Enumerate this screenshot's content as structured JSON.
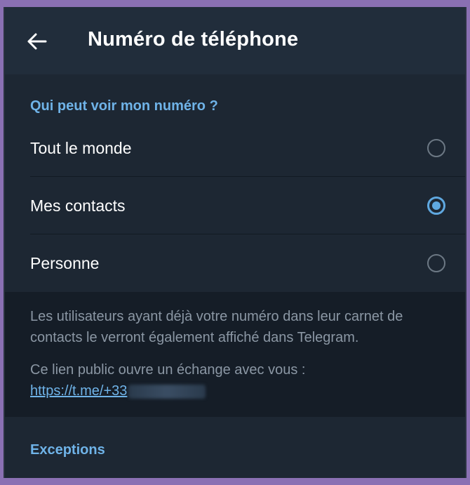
{
  "header": {
    "title": "Numéro de téléphone",
    "back_icon": "arrow-left-icon"
  },
  "privacy": {
    "section_title": "Qui peut voir mon numéro ?",
    "options": [
      {
        "label": "Tout le monde",
        "selected": false
      },
      {
        "label": "Mes contacts",
        "selected": true
      },
      {
        "label": "Personne",
        "selected": false
      }
    ]
  },
  "info": {
    "description": "Les utilisateurs ayant déjà votre numéro dans leur carnet de contacts le verront également affiché dans Telegram.",
    "public_link_text": "Ce lien public ouvre un échange avec vous :",
    "public_link": "https://t.me/+33"
  },
  "exceptions": {
    "title": "Exceptions"
  },
  "colors": {
    "accent": "#5fa8e0",
    "background": "#1d2733",
    "appbar": "#212d3b",
    "info_background": "#151d27"
  }
}
